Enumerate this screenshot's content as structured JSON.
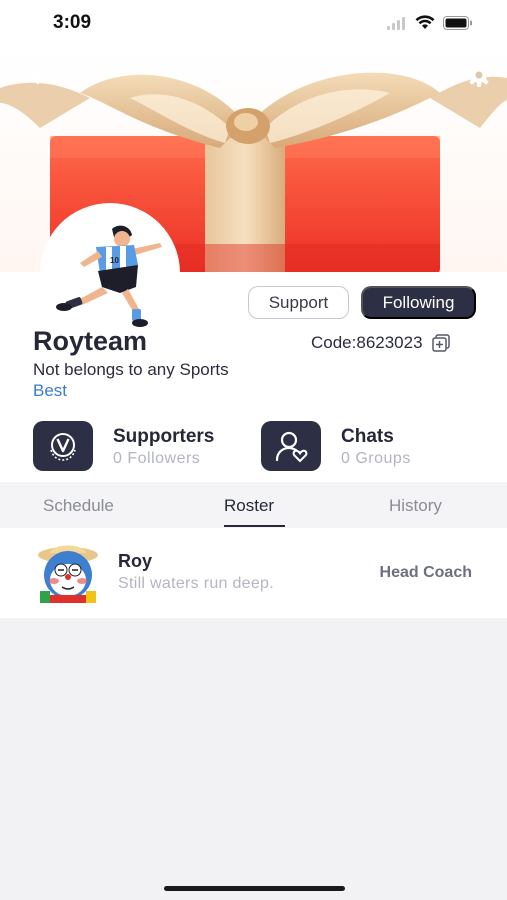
{
  "status_bar": {
    "time": "3:09"
  },
  "team": {
    "name": "Royteam",
    "code": "Code:8623023",
    "sport": "Not belongs to any Sports",
    "tag": "Best"
  },
  "actions": {
    "support_label": "Support",
    "following_label": "Following"
  },
  "stats": {
    "supporters": {
      "title": "Supporters",
      "sub": "0 Followers"
    },
    "chats": {
      "title": "Chats",
      "sub": "0 Groups"
    }
  },
  "tabs": [
    {
      "label": "Schedule",
      "active": false
    },
    {
      "label": "Roster",
      "active": true
    },
    {
      "label": "History",
      "active": false
    }
  ],
  "roster": [
    {
      "name": "Roy",
      "bio": "Still waters run deep.",
      "role": "Head Coach"
    }
  ],
  "colors": {
    "dark_accent": "#2d2f44",
    "link": "#3a7bd5",
    "muted": "#b3b5c0"
  },
  "icons": {
    "back": "back-arrow-icon",
    "settings": "gear-icon",
    "copy": "copy-icon",
    "supporters": "v-badge-icon",
    "chats": "person-heart-icon"
  }
}
